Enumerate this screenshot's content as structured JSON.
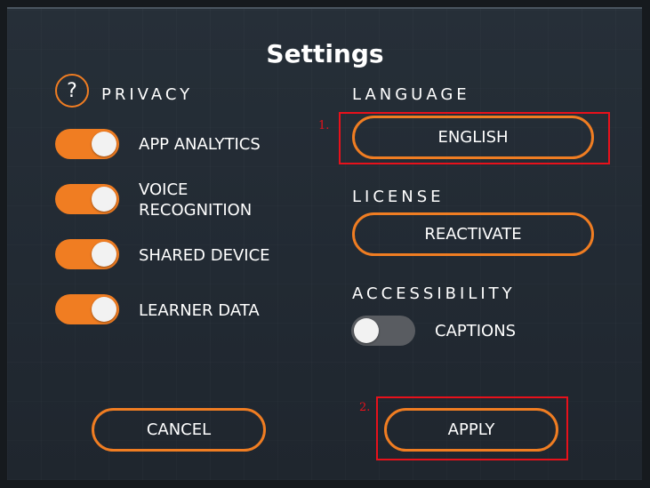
{
  "dialog": {
    "title": "Settings"
  },
  "privacy": {
    "help_glyph": "?",
    "heading": "PRIVACY",
    "toggles": [
      {
        "label": "APP ANALYTICS",
        "on": true
      },
      {
        "label_line1": "VOICE",
        "label_line2": "RECOGNITION",
        "on": true
      },
      {
        "label": "SHARED DEVICE",
        "on": true
      },
      {
        "label": "LEARNER DATA",
        "on": true
      }
    ]
  },
  "language": {
    "heading": "LANGUAGE",
    "button_label": "ENGLISH"
  },
  "license": {
    "heading": "LICENSE",
    "button_label": "REACTIVATE"
  },
  "accessibility": {
    "heading": "ACCESSIBILITY",
    "captions_label": "CAPTIONS",
    "captions_on": false
  },
  "footer": {
    "cancel_label": "CANCEL",
    "apply_label": "APPLY"
  },
  "annotations": {
    "marker1": "1.",
    "marker2": "2."
  },
  "colors": {
    "accent": "#f07d22",
    "toggle_off": "#595c61",
    "annotation": "#e8111b"
  }
}
